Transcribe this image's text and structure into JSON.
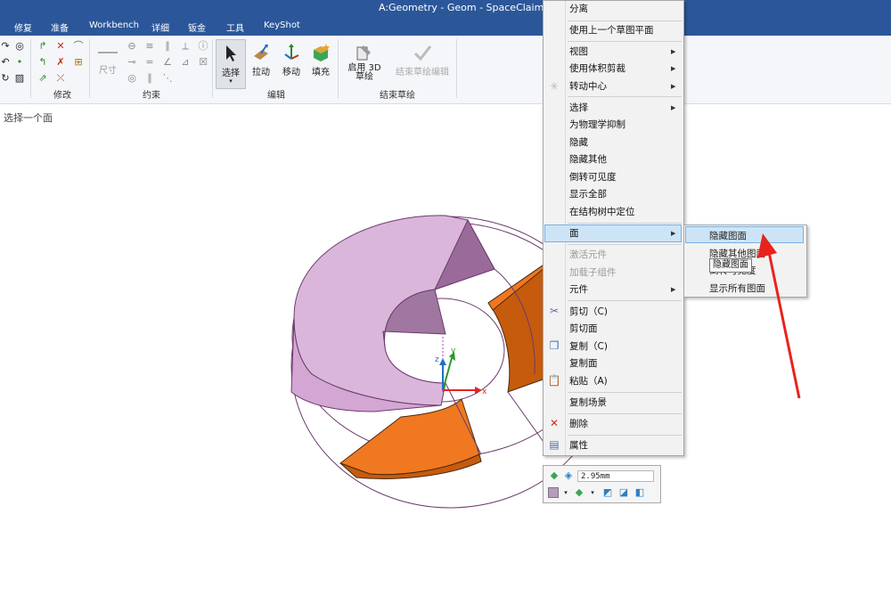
{
  "window": {
    "title": "A:Geometry - Geom - SpaceClaim"
  },
  "tabs": [
    "修复",
    "准备",
    "Workbench",
    "详细",
    "钣金",
    "工具",
    "KeyShot"
  ],
  "ribbon": {
    "groups": {
      "modify": "修改",
      "constraint": "约束",
      "edit": "编辑",
      "end_sketch": "结束草绘"
    },
    "buttons": {
      "dimension": "尺寸",
      "select": "选择",
      "pull": "拉动",
      "move": "移动",
      "fill": "填充",
      "enable_3d_sketch": "启用 3D 草绘",
      "end_sketch_edit": "结束草绘编辑"
    }
  },
  "status_hint": "选择一个面",
  "context_menu": {
    "items": [
      {
        "label": "分离",
        "disabled": false
      },
      {
        "label": "使用上一个草图平面",
        "disabled": false
      },
      {
        "label": "视图",
        "submenu": true
      },
      {
        "label": "使用体积剪裁",
        "submenu": true
      },
      {
        "label": "转动中心",
        "submenu": true
      },
      {
        "label": "选择",
        "submenu": true
      },
      {
        "label": "为物理学抑制"
      },
      {
        "label": "隐藏"
      },
      {
        "label": "隐藏其他"
      },
      {
        "label": "倒转可见度"
      },
      {
        "label": "显示全部"
      },
      {
        "label": "在结构树中定位"
      },
      {
        "label": "面",
        "submenu": true,
        "highlighted": true
      },
      {
        "label": "激活元件",
        "disabled": true
      },
      {
        "label": "加载子组件",
        "disabled": true
      },
      {
        "label": "元件",
        "submenu": true
      },
      {
        "label": "剪切（C)"
      },
      {
        "label": "剪切面"
      },
      {
        "label": "复制（C)"
      },
      {
        "label": "复制面"
      },
      {
        "label": "粘贴（A)"
      },
      {
        "label": "复制场景"
      },
      {
        "label": "删除"
      },
      {
        "label": "属性"
      }
    ]
  },
  "face_submenu": {
    "items": [
      "隐藏图面",
      "隐藏其他图面",
      "倒转可见度",
      "显示所有图面"
    ],
    "highlighted": "隐藏图面",
    "tooltip": "隐藏图面"
  },
  "mini_toolbar": {
    "dimension_value": "2.95mm"
  },
  "viewport": {
    "axes": {
      "x": "x",
      "y": "y",
      "z": "z"
    },
    "colors": {
      "pink_face": "#dbb6db",
      "orange_face": "#f07820",
      "dark_orange": "#c65b0d",
      "edge": "#6b3a6b"
    }
  },
  "colors": {
    "title_bar": "#2b579a",
    "menu_highlight": "#cde4f7",
    "arrow": "#e8231c"
  }
}
